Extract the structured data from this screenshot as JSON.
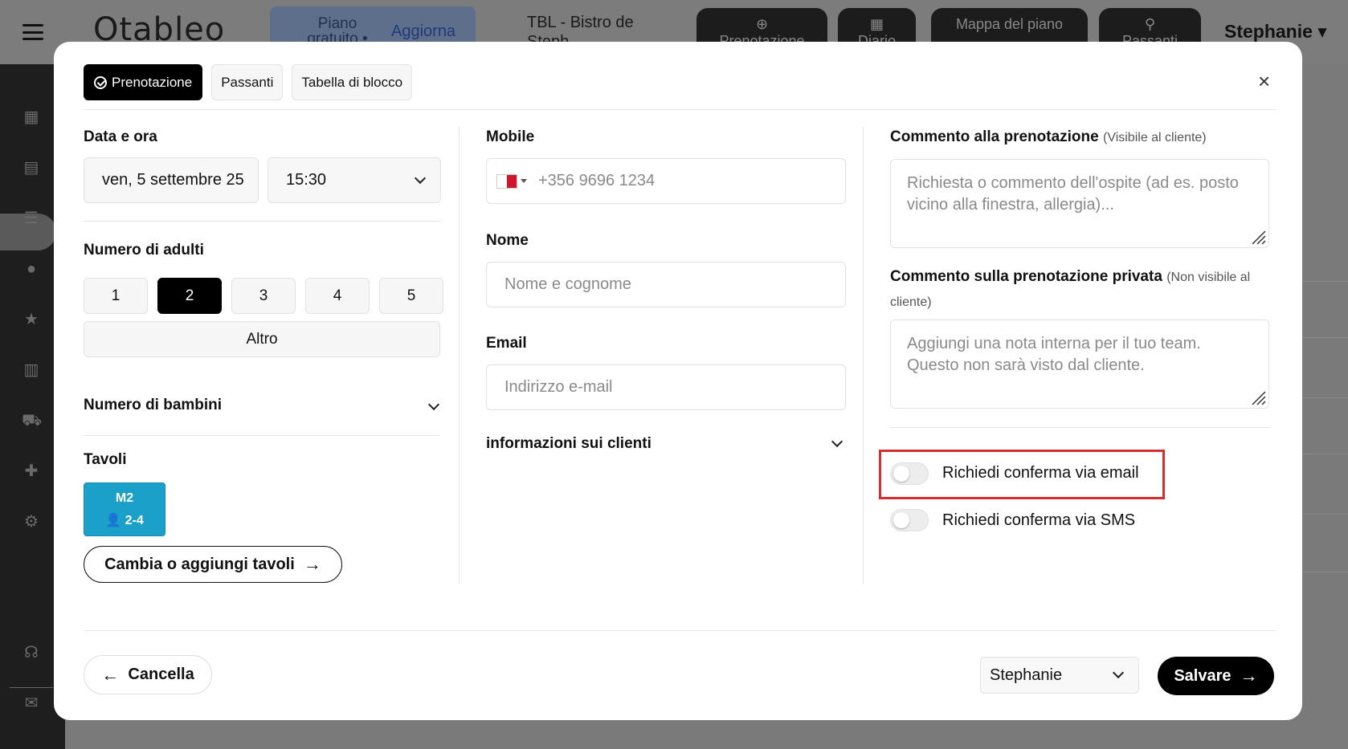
{
  "app": {
    "logo": "Otableo",
    "plan_label": "Piano gratuito •",
    "upgrade_label": "Aggiorna",
    "venue": "TBL - Bistro de Steph",
    "top_buttons": [
      "Prenotazione",
      "Diario",
      "Mappa del piano",
      "Passanti"
    ],
    "user": "Stephanie"
  },
  "sidebar": {
    "icons": [
      "dashboard-icon",
      "book-icon",
      "list-icon",
      "user-icon",
      "star-icon",
      "chart-icon",
      "cart-icon",
      "puzzle-icon",
      "gear-icon",
      "headset-icon",
      "chat-icon"
    ]
  },
  "modal": {
    "tabs": [
      "Prenotazione",
      "Passanti",
      "Tabella di blocco"
    ],
    "close_label": "×",
    "date_time": {
      "label": "Data e ora",
      "date": "ven, 5 settembre 25",
      "time": "15:30"
    },
    "adults": {
      "label": "Numero di adulti",
      "options": [
        "1",
        "2",
        "3",
        "4",
        "5"
      ],
      "selected": "2",
      "other_label": "Altro"
    },
    "children": {
      "label": "Numero di bambini"
    },
    "tables": {
      "label": "Tavoli",
      "selected_table": {
        "name": "M2",
        "capacity": "2-4"
      },
      "change_button": "Cambia o aggiungi tavoli"
    },
    "mobile": {
      "label": "Mobile",
      "placeholder": "+356 9696 1234",
      "country": "MT"
    },
    "name": {
      "label": "Nome",
      "placeholder": "Nome e cognome"
    },
    "email": {
      "label": "Email",
      "placeholder": "Indirizzo e-mail"
    },
    "client_info": {
      "label": "informazioni sui clienti"
    },
    "comment": {
      "label": "Commento alla prenotazione",
      "hint": "(Visibile al cliente)",
      "placeholder": "Richiesta o commento dell'ospite (ad es. posto vicino alla finestra, allergia)..."
    },
    "private_comment": {
      "label": "Commento sulla prenotazione privata",
      "hint": "(Non visibile al cliente)",
      "placeholder": "Aggiungi una nota interna per il tuo team. Questo non sarà visto dal cliente."
    },
    "toggles": {
      "email_confirm": {
        "label": "Richiedi conferma via email",
        "on": false
      },
      "sms_confirm": {
        "label": "Richiedi conferma via SMS",
        "on": false
      }
    },
    "footer": {
      "cancel_label": "Cancella",
      "staff_select": "Stephanie",
      "save_label": "Salvare"
    }
  },
  "colors": {
    "accent": "#000000",
    "table_selected": "#1ba0c9",
    "highlight": "#d32f2f"
  }
}
